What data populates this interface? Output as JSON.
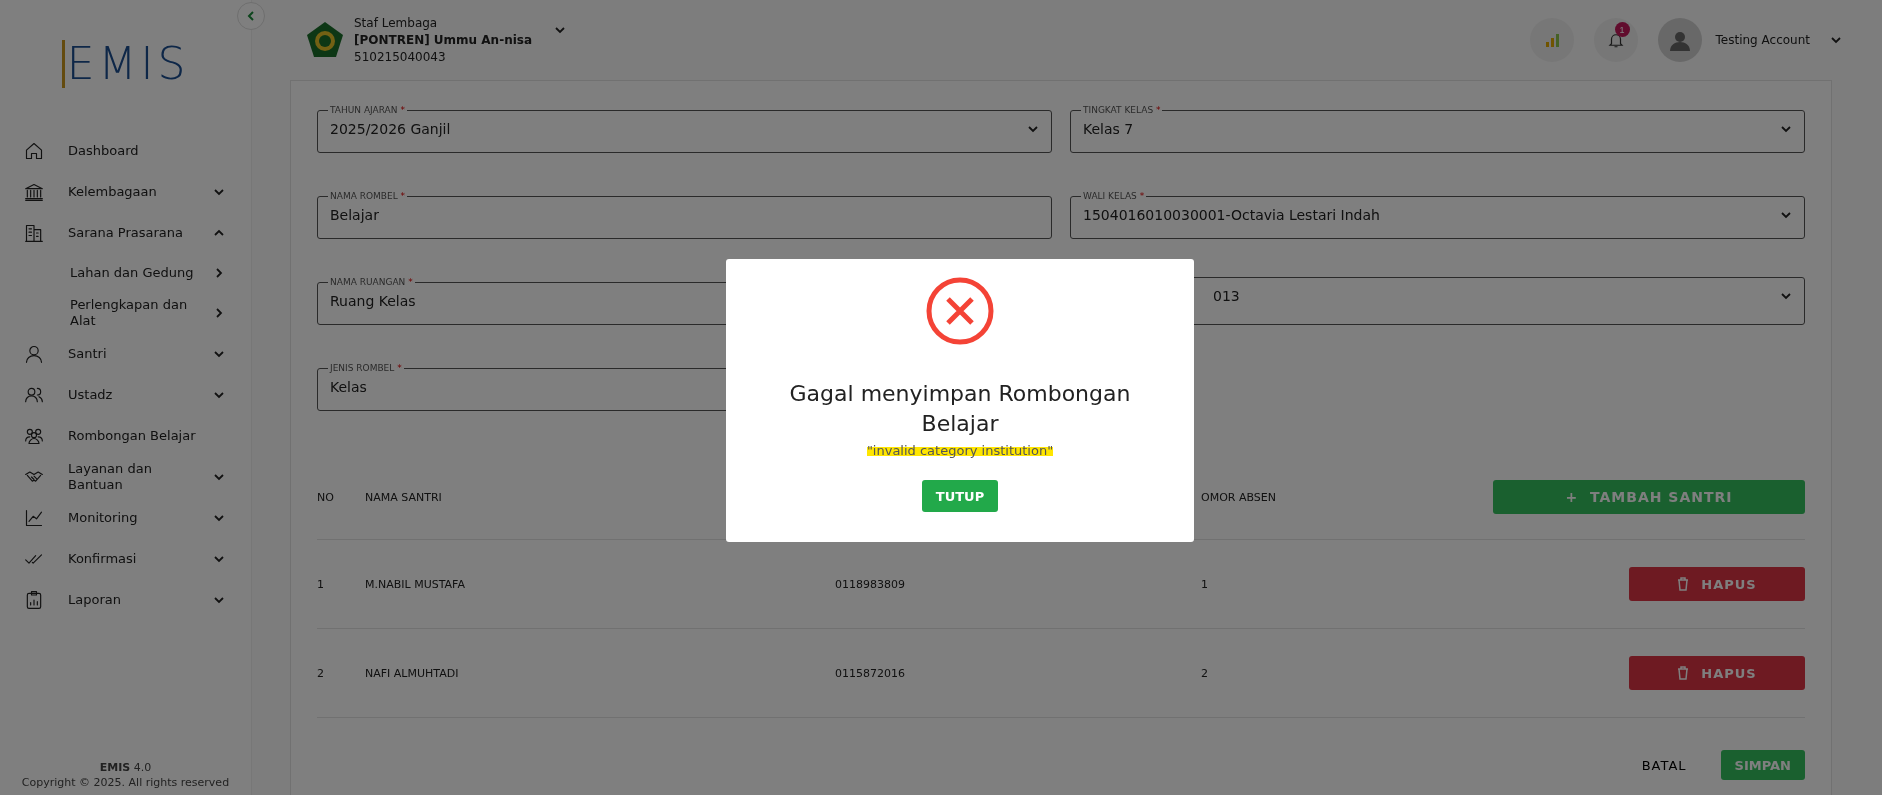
{
  "sidebar": {
    "logo": "EMIS",
    "items": [
      {
        "label": "Dashboard",
        "kind": "link"
      },
      {
        "label": "Kelembagaan",
        "kind": "group",
        "expanded": false
      },
      {
        "label": "Sarana Prasarana",
        "kind": "group",
        "expanded": true,
        "children": [
          {
            "label": "Lahan dan Gedung"
          },
          {
            "label": "Perlengkapan dan Alat"
          }
        ]
      },
      {
        "label": "Santri",
        "kind": "group",
        "expanded": false
      },
      {
        "label": "Ustadz",
        "kind": "group",
        "expanded": false
      },
      {
        "label": "Rombongan Belajar",
        "kind": "link"
      },
      {
        "label": "Layanan dan Bantuan",
        "kind": "group",
        "expanded": false
      },
      {
        "label": "Monitoring",
        "kind": "group",
        "expanded": false
      },
      {
        "label": "Konfirmasi",
        "kind": "group",
        "expanded": false
      },
      {
        "label": "Laporan",
        "kind": "group",
        "expanded": false
      }
    ],
    "footer": {
      "app": "EMIS",
      "version": "4.0",
      "copyright": "Copyright © 2025. All rights reserved"
    }
  },
  "header": {
    "role": "Staf Lembaga",
    "institution": "[PONTREN] Ummu An-nisa",
    "code": "510215040043",
    "notification_count": "1",
    "user": "Testing Account"
  },
  "form": {
    "fields": [
      {
        "label": "TAHUN AJARAN",
        "required_mark": "*",
        "value": "2025/2026 Ganjil",
        "kind": "select"
      },
      {
        "label": "TINGKAT KELAS",
        "required_mark": "*",
        "value": "Kelas 7",
        "kind": "select"
      },
      {
        "label": "NAMA ROMBEL",
        "required_mark": "*",
        "value": "Belajar",
        "kind": "text"
      },
      {
        "label": "WALI KELAS",
        "required_mark": "*",
        "value": "1504016010030001-Octavia Lestari Indah",
        "kind": "select"
      },
      {
        "label": "NAMA RUANGAN",
        "required_mark": "*",
        "value": "Ruang Kelas",
        "kind": "text"
      },
      {
        "value": "013",
        "kind": "select"
      },
      {
        "label": "JENIS ROMBEL",
        "required_mark": "*",
        "value": "Kelas",
        "kind": "text"
      }
    ]
  },
  "table": {
    "columns": [
      {
        "label": "NO"
      },
      {
        "label": "NAMA SANTRI"
      },
      {},
      {
        "label": "OMOR ABSEN"
      }
    ],
    "add_button": "TAMBAH SANTRI",
    "add_icon": "+",
    "rows": [
      {
        "cells": [
          "1",
          "M.NABIL MUSTAFA",
          "0118983809",
          "1"
        ],
        "action": "HAPUS"
      },
      {
        "cells": [
          "2",
          "NAFI ALMUHTADI",
          "0115872016",
          "2"
        ],
        "action": "HAPUS"
      }
    ]
  },
  "actions": {
    "cancel": "BATAL",
    "save": "SIMPAN"
  },
  "dialog": {
    "title": "Gagal menyimpan Rombongan Belajar",
    "message": "\"invalid category institution\"",
    "button": "TUTUP"
  }
}
